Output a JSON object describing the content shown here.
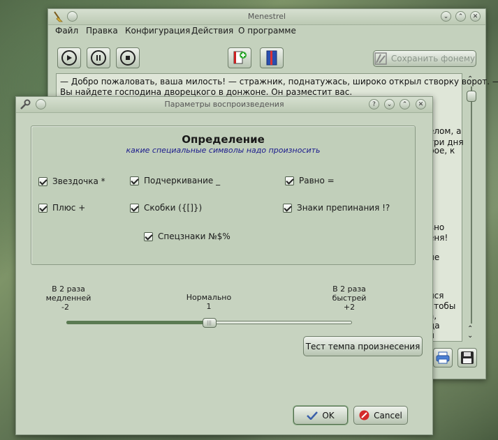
{
  "main_window": {
    "title": "Menestrel",
    "menu": [
      "Файл",
      "Правка",
      "Конфигурация",
      "Действия",
      "О программе"
    ],
    "save_phoneme_label": "Сохранить фонему",
    "text_lines": [
      "— Добро пожаловать, ваша милость! — стражник, поднатужась, широко открыл створку ворот. —",
      "Вы найдете господина дворецкого в донжоне. Он разместит вас."
    ],
    "text_right_fragments": [
      "о",
      "елом, а",
      "три дня",
      "рое, к",
      "вно",
      "еня!",
      "не",
      "лся",
      "чтобы",
      "а,",
      "да",
      "н"
    ]
  },
  "dialog": {
    "title": "Параметры воспроизведения",
    "heading": "Определение",
    "subheading": "какие специальные символы надо произносить",
    "checkboxes": {
      "asterisk": "Звездочка *",
      "underscore": "Подчеркивание _",
      "equals": "Равно =",
      "plus": "Плюс +",
      "brackets": "Скобки ({[]})",
      "punctuation": "Знаки препинания !?",
      "special": "Спецзнаки №$%"
    },
    "speed": {
      "slow_line1": "В 2 раза",
      "slow_line2": "медленней",
      "slow_value": "-2",
      "normal_label": "Нормально",
      "normal_value": "1",
      "fast_line1": "В 2 раза",
      "fast_line2": "быстрей",
      "fast_value": "+2",
      "min": -2,
      "max": 2,
      "current": 0
    },
    "test_button": "Тест темпа произнесения",
    "ok_label": "OK",
    "cancel_label": "Cancel"
  },
  "colors": {
    "window_bg": "#c4d1bd",
    "slider_fill": "#5a7a52",
    "link_text": "#1a1a8c"
  },
  "icons": [
    "broom-icon",
    "play-icon",
    "pause-icon",
    "stop-icon",
    "add-document-icon",
    "book-icon",
    "wrench-icon",
    "help-icon",
    "printer-icon",
    "floppy-icon",
    "check-icon",
    "cancel-icon"
  ]
}
